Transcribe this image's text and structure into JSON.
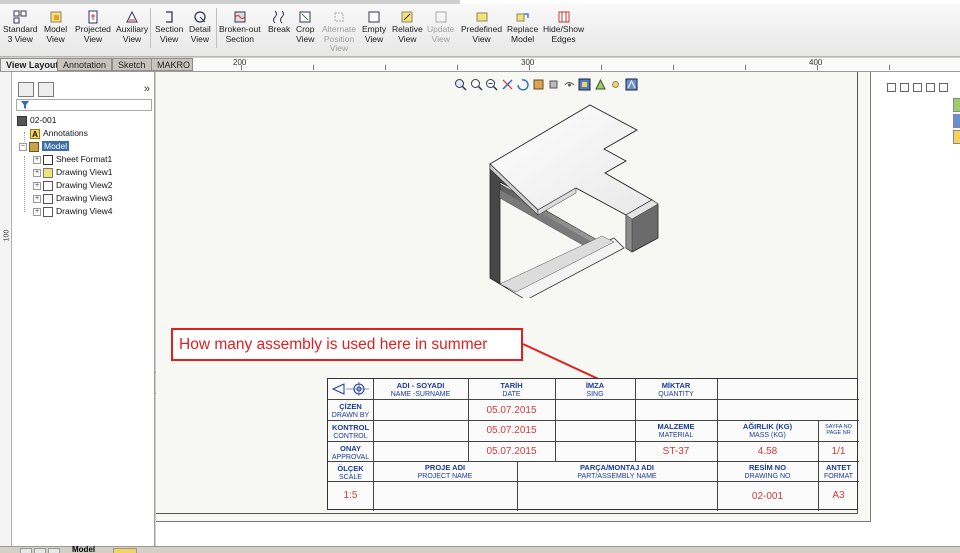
{
  "ribbon": {
    "buttons": [
      {
        "line1": "Standard",
        "line2": "3 View"
      },
      {
        "line1": "Model",
        "line2": "View"
      },
      {
        "line1": "Projected",
        "line2": "View"
      },
      {
        "line1": "Auxiliary",
        "line2": "View"
      },
      {
        "line1": "Section",
        "line2": "View"
      },
      {
        "line1": "Detail",
        "line2": "View"
      },
      {
        "line1": "Broken-out",
        "line2": "Section"
      },
      {
        "line1": "Break",
        "line2": ""
      },
      {
        "line1": "Crop",
        "line2": "View"
      },
      {
        "line1": "Alternate",
        "line2": "Position",
        "line3": "View"
      },
      {
        "line1": "Empty",
        "line2": "View"
      },
      {
        "line1": "Relative",
        "line2": "View"
      },
      {
        "line1": "Update",
        "line2": "View"
      },
      {
        "line1": "Predefined",
        "line2": "View"
      },
      {
        "line1": "Replace",
        "line2": "Model"
      },
      {
        "line1": "Hide/Show",
        "line2": "Edges"
      }
    ]
  },
  "tabs": [
    "View Layout",
    "Annotation",
    "Sketch",
    "MAKRO"
  ],
  "ruler": {
    "h_labels": [
      "200",
      "300",
      "400"
    ],
    "v_label": "100"
  },
  "tree": {
    "root": "02-001",
    "items": [
      "Annotations",
      "Model",
      "Sheet Format1",
      "Drawing View1",
      "Drawing View2",
      "Drawing View3",
      "Drawing View4"
    ]
  },
  "callout": {
    "text": "How many assembly is used here in summer"
  },
  "title_block": {
    "header": {
      "name_tr": "ADI - SOYADI",
      "name_en": "NAME -SURNAME",
      "date_tr": "TARİH",
      "date_en": "DATE",
      "sign_tr": "İMZA",
      "sign_en": "SING",
      "qty_tr": "MİKTAR",
      "qty_en": "QUANTITY"
    },
    "rows": {
      "drawn_tr": "ÇİZEN",
      "drawn_en": "DRAWN BY",
      "control_tr": "KONTROL",
      "control_en": "CONTROL",
      "approval_tr": "ONAY",
      "approval_en": "APPROVAL",
      "scale_tr": "ÖLÇEK",
      "scale_en": "SCALE"
    },
    "dates": [
      "05.07.2015",
      "05.07.2015",
      "05.07.2015"
    ],
    "material_tr": "MALZEME",
    "material_en": "MATERIAL",
    "material_value": "ST-37",
    "mass_tr": "AĞIRLIK (KG)",
    "mass_en": "MASS (KG)",
    "mass_value": "4.58",
    "page_tr": "SAYFA NO",
    "page_en": "PAGE NR",
    "page_value": "1/1",
    "project_tr": "PROJE ADI",
    "project_en": "PROJECT NAME",
    "part_tr": "PARÇA/MONTAJ ADI",
    "part_en": "PART/ASSEMBLY NAME",
    "drawing_tr": "RESİM NO",
    "drawing_en": "DRAWING NO",
    "drawing_value": "02-001",
    "format_tr": "ANTET",
    "format_en": "FORMAT",
    "format_value": "A3",
    "scale_value": "1:5"
  },
  "bottom": {
    "model_tab": "Model"
  },
  "colors": {
    "callout": "#e0201f",
    "title_block_text": "#1a3a9a",
    "values": "#d43a3a"
  }
}
